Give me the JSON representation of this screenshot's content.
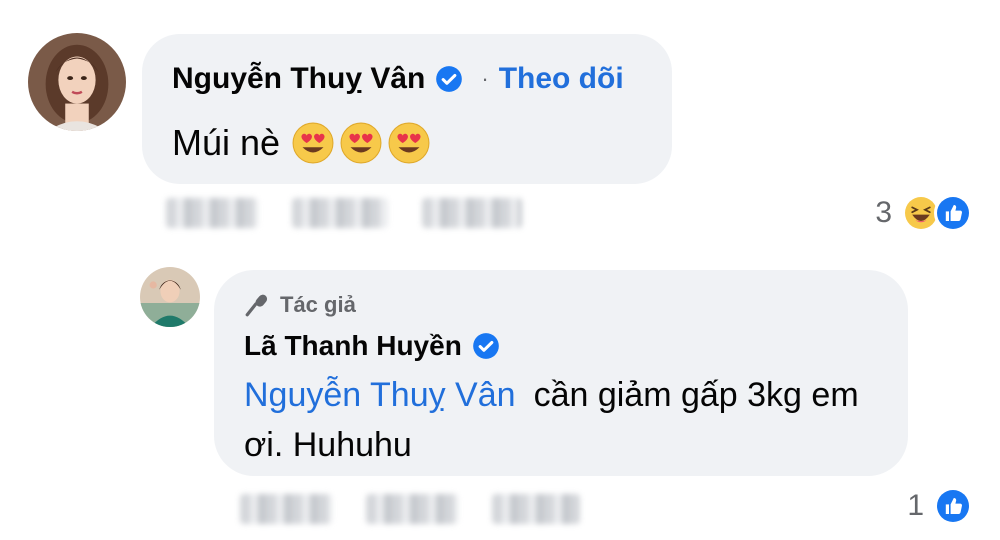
{
  "comment1": {
    "author": "Nguyễn Thuỵ Vân",
    "follow_label": "Theo dõi",
    "separator": "·",
    "text": "Múi nè",
    "emoji": [
      "heart-eyes",
      "heart-eyes",
      "heart-eyes"
    ],
    "reaction_count": "3",
    "reactions": [
      "haha-icon",
      "like-icon"
    ]
  },
  "comment2": {
    "badge": "Tác giả",
    "author": "Lã Thanh Huyền",
    "mention": "Nguyễn Thuỵ Vân",
    "text": "cần giảm gấp 3kg em ơi. Huhuhu",
    "reaction_count": "1",
    "reactions": [
      "like-icon"
    ]
  },
  "colors": {
    "bubble": "#f0f2f5",
    "link": "#216fdb",
    "secondary_text": "#65676b",
    "like_blue": "#1877f2"
  }
}
